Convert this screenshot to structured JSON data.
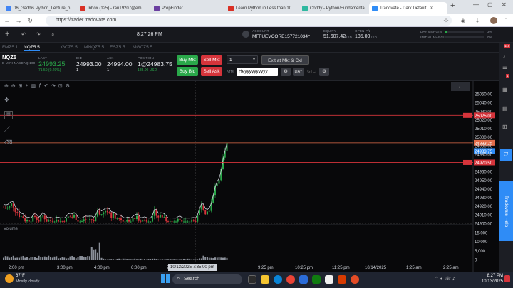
{
  "browser": {
    "tabs": [
      {
        "label": "06_Gaddis Python_Lecture_p...",
        "color": "#4285f4",
        "active": false
      },
      {
        "label": "Inbox (125) - ran19207@em...",
        "color": "#d93025",
        "active": false
      },
      {
        "label": "PropFinder",
        "color": "#6b3fa0",
        "active": false
      },
      {
        "label": "Learn Python in Less than 10...",
        "color": "#d93025",
        "active": false
      },
      {
        "label": "Coddy - Python/Fundamenta...",
        "color": "#2fb8a0",
        "active": false
      },
      {
        "label": "Tradovate - Dark Default",
        "color": "#2f8cf6",
        "active": true
      }
    ],
    "url": "https://trader.tradovate.com"
  },
  "header": {
    "time": "8:27:26 PM",
    "account_label": "ACCOUNT",
    "account_value": "MFFUEVCORE157721034",
    "equity_label": "EQUITY",
    "equity_value": "51,607.42",
    "equity_unit": "USD",
    "openpl_label": "OPEN P/L",
    "openpl_value": "185.00",
    "openpl_unit": "USD",
    "day_margin_label": "DAY MARGIN",
    "day_margin_value": "3%",
    "initial_margin_label": "INITIAL MARGIN",
    "initial_margin_value": "0%"
  },
  "symbol_tabs": [
    {
      "label": "FMZ5 1",
      "active": false
    },
    {
      "label": "NQZ5 5",
      "active": true
    },
    {
      "label": "GCZ5 5",
      "active": false
    },
    {
      "label": "MNQZ5 5",
      "active": false
    },
    {
      "label": "ESZ5 5",
      "active": false
    },
    {
      "label": "MGCZ5 5",
      "active": false
    }
  ],
  "quote": {
    "symbol": "NQZ5",
    "desc": "E-MINI NASDAQ 100",
    "last_label": "LAST",
    "last_value": "24993.25",
    "last_change": "71.50 (0.29%)",
    "bid_label": "BID",
    "bid_value": "24993.00",
    "bid_size": "1",
    "ask_label": "ASK",
    "ask_value": "24994.00",
    "ask_size": "1",
    "position_label": "POSITION",
    "position_value": "1@24983.75",
    "position_pl": "185.00 USD",
    "buy_mkt": "Buy Mkt",
    "sell_mkt": "Sell Mkt",
    "buy_bid": "Buy Bid",
    "sell_ask": "Sell Ask",
    "qty": "1",
    "exit_label": "Exit at Mkt & Cxl",
    "atm_label": "ATM",
    "atm_value": "Heyyyyyyyyyy",
    "tif_day": "DAY",
    "tif_gtc": "GTC"
  },
  "chart": {
    "price_labels": [
      "25050.00",
      "25040.00",
      "25030.00",
      "25025.00",
      "25020.00",
      "25010.00",
      "25000.00",
      "24993.25",
      "24990.00",
      "24983.75",
      "24980.00",
      "24970.50",
      "24960.00",
      "24950.00",
      "24940.00",
      "24930.00",
      "24920.00",
      "24910.00",
      "24900.00"
    ],
    "time_labels": [
      "2:00 pm",
      "3:00 pm",
      "4:00 pm",
      "6:00 pm",
      "7:",
      "9:25 pm",
      "10:25 pm",
      "11:25 pm",
      "10/14/2025",
      "1:25 am",
      "2:25 am"
    ],
    "cursor_time": "10/13/2025 7:35:00 pm",
    "volume_label": "Volume",
    "volume_ticks": [
      "15,000",
      "10,000",
      "5,000",
      "0"
    ],
    "order_tags": [
      {
        "price": "25025.00",
        "color": "#d6343b"
      },
      {
        "price": "24993.25",
        "color": "#e26d4a"
      },
      {
        "price": "24983.75",
        "color": "#2f8cf6"
      },
      {
        "price": "24970.50",
        "color": "#d6343b"
      }
    ]
  },
  "right_rail": {
    "help_label": "Tradovate Help",
    "badge1": "116",
    "badge2": "1"
  },
  "taskbar": {
    "weather_temp": "67°F",
    "weather_desc": "Mostly cloudy",
    "search_placeholder": "Search",
    "clock_time": "8:27 PM",
    "clock_date": "10/13/2025"
  }
}
